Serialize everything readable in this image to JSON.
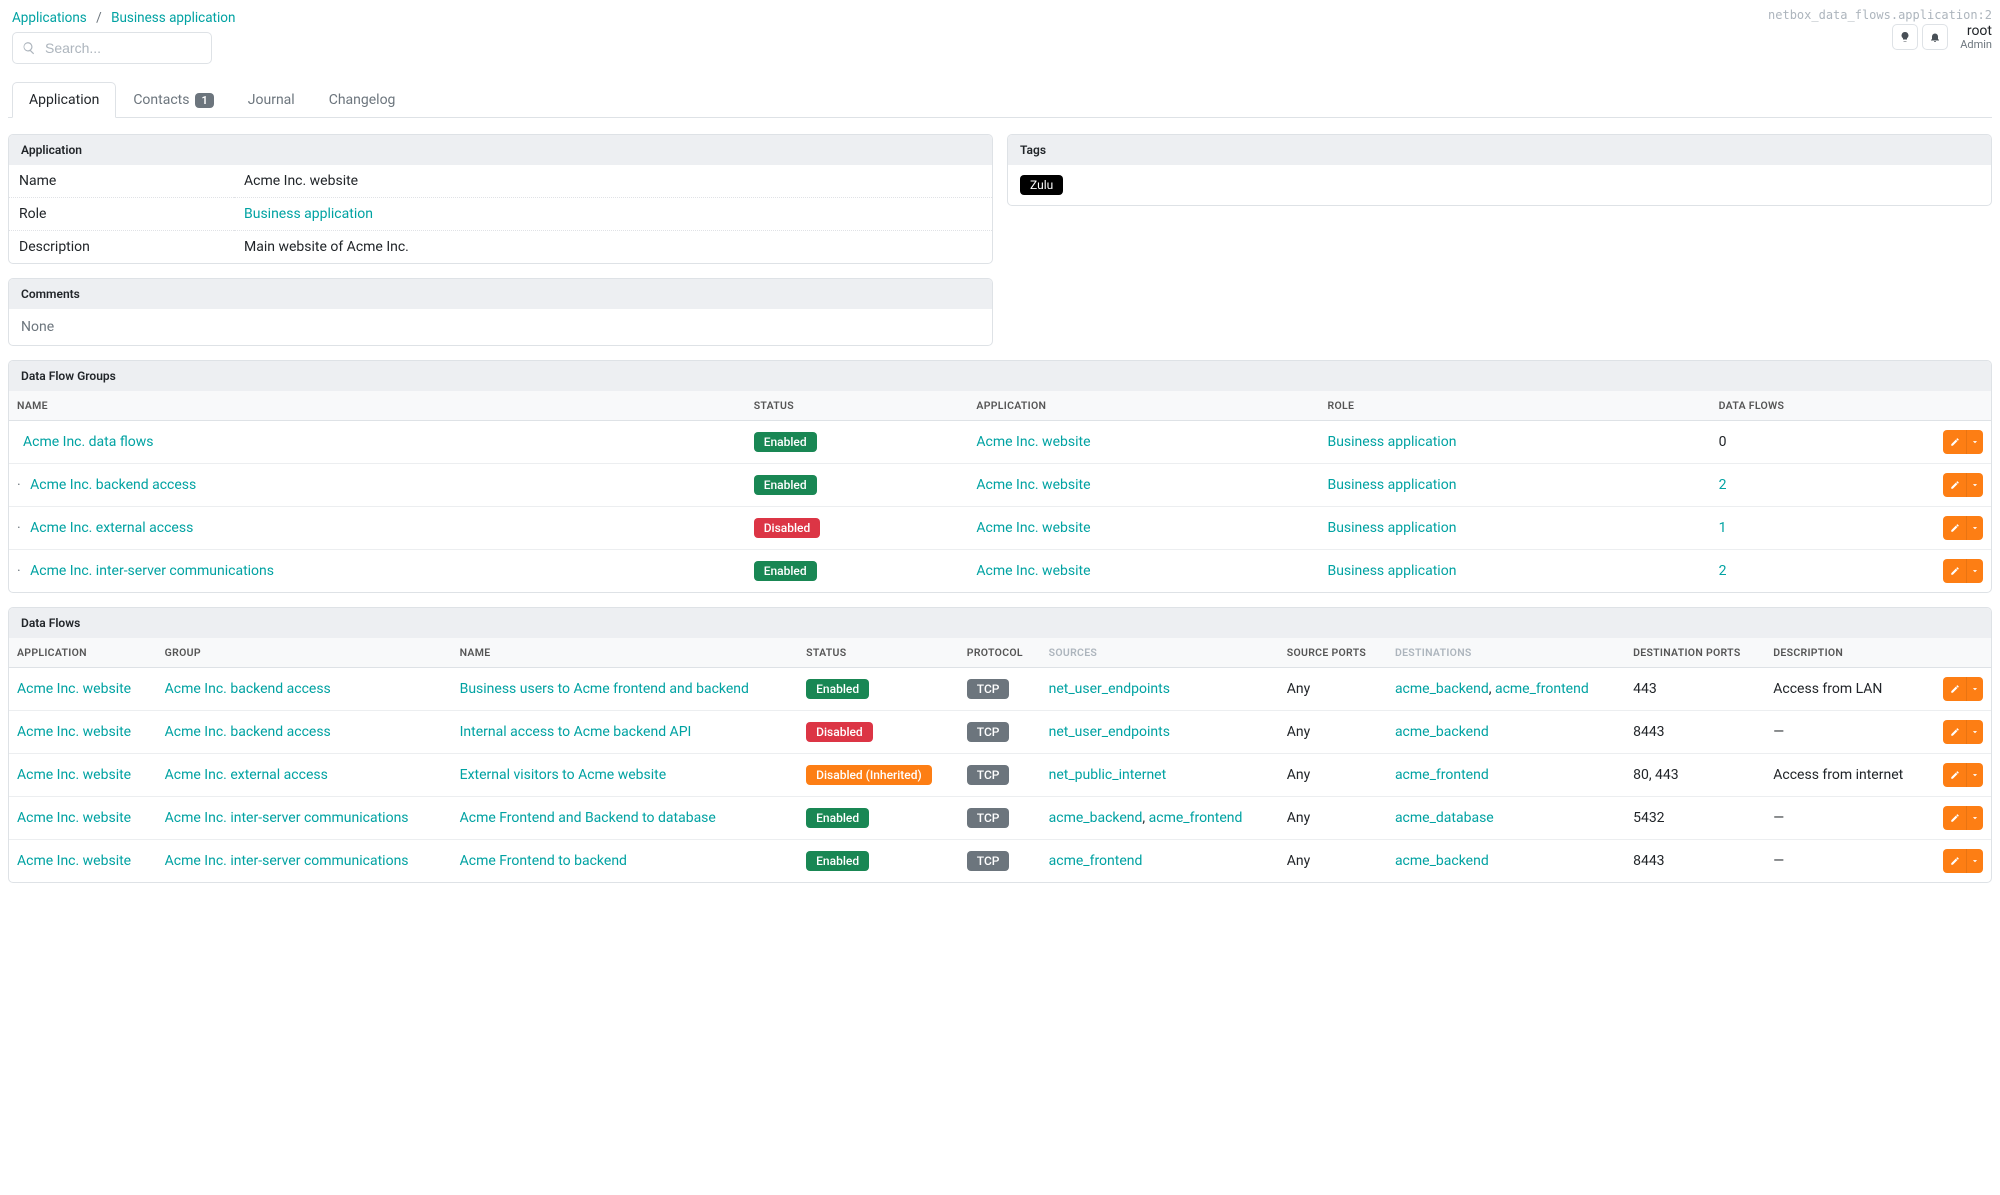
{
  "context_string": "netbox_data_flows.application:2",
  "breadcrumb": {
    "root": "Applications",
    "item": "Business application"
  },
  "search": {
    "placeholder": "Search..."
  },
  "user": {
    "name": "root",
    "role": "Admin"
  },
  "tabs": {
    "application": "Application",
    "contacts": "Contacts",
    "contacts_count": "1",
    "journal": "Journal",
    "changelog": "Changelog"
  },
  "cards": {
    "application_header": "Application",
    "tags_header": "Tags",
    "comments_header": "Comments",
    "dfg_header": "Data Flow Groups",
    "df_header": "Data Flows"
  },
  "app_fields": {
    "name_k": "Name",
    "name_v": "Acme Inc. website",
    "role_k": "Role",
    "role_v": "Business application",
    "desc_k": "Description",
    "desc_v": "Main website of Acme Inc."
  },
  "tags": {
    "zulu": "Zulu"
  },
  "comments": {
    "none": "None"
  },
  "dfg_cols": {
    "name": "Name",
    "status": "Status",
    "application": "Application",
    "role": "Role",
    "flows": "Data Flows"
  },
  "dfg_rows": [
    {
      "indent": "",
      "name": "Acme Inc. data flows",
      "status": "Enabled",
      "status_cls": "green",
      "app": "Acme Inc. website",
      "role": "Business application",
      "flows": "0",
      "flows_link": false
    },
    {
      "indent": "·  ",
      "name": "Acme Inc. backend access",
      "status": "Enabled",
      "status_cls": "green",
      "app": "Acme Inc. website",
      "role": "Business application",
      "flows": "2",
      "flows_link": true
    },
    {
      "indent": "·  ",
      "name": "Acme Inc. external access",
      "status": "Disabled",
      "status_cls": "red",
      "app": "Acme Inc. website",
      "role": "Business application",
      "flows": "1",
      "flows_link": true
    },
    {
      "indent": "·  ",
      "name": "Acme Inc. inter-server communications",
      "status": "Enabled",
      "status_cls": "green",
      "app": "Acme Inc. website",
      "role": "Business application",
      "flows": "2",
      "flows_link": true
    }
  ],
  "df_cols": {
    "application": "Application",
    "group": "Group",
    "name": "Name",
    "status": "Status",
    "protocol": "Protocol",
    "sources": "Sources",
    "src_ports": "Source Ports",
    "destinations": "Destinations",
    "dst_ports": "Destination Ports",
    "description": "Description"
  },
  "df_rows": [
    {
      "app": "Acme Inc. website",
      "group": "Acme Inc. backend access",
      "name": "Business users to Acme frontend and backend",
      "status": "Enabled",
      "status_cls": "green",
      "proto": "TCP",
      "sources": [
        "net_user_endpoints"
      ],
      "src_ports": "Any",
      "dests": [
        "acme_backend",
        "acme_frontend"
      ],
      "dst_ports": "443",
      "desc": "Access from LAN"
    },
    {
      "app": "Acme Inc. website",
      "group": "Acme Inc. backend access",
      "name": "Internal access to Acme backend API",
      "status": "Disabled",
      "status_cls": "red",
      "proto": "TCP",
      "sources": [
        "net_user_endpoints"
      ],
      "src_ports": "Any",
      "dests": [
        "acme_backend"
      ],
      "dst_ports": "8443",
      "desc": "—"
    },
    {
      "app": "Acme Inc. website",
      "group": "Acme Inc. external access",
      "name": "External visitors to Acme website",
      "status": "Disabled (Inherited)",
      "status_cls": "orange",
      "proto": "TCP",
      "sources": [
        "net_public_internet"
      ],
      "src_ports": "Any",
      "dests": [
        "acme_frontend"
      ],
      "dst_ports": "80, 443",
      "desc": "Access from internet"
    },
    {
      "app": "Acme Inc. website",
      "group": "Acme Inc. inter-server communications",
      "name": "Acme Frontend and Backend to database",
      "status": "Enabled",
      "status_cls": "green",
      "proto": "TCP",
      "sources": [
        "acme_backend",
        "acme_frontend"
      ],
      "src_ports": "Any",
      "dests": [
        "acme_database"
      ],
      "dst_ports": "5432",
      "desc": "—"
    },
    {
      "app": "Acme Inc. website",
      "group": "Acme Inc. inter-server communications",
      "name": "Acme Frontend to backend",
      "status": "Enabled",
      "status_cls": "green",
      "proto": "TCP",
      "sources": [
        "acme_frontend"
      ],
      "src_ports": "Any",
      "dests": [
        "acme_backend"
      ],
      "dst_ports": "8443",
      "desc": "—"
    }
  ]
}
